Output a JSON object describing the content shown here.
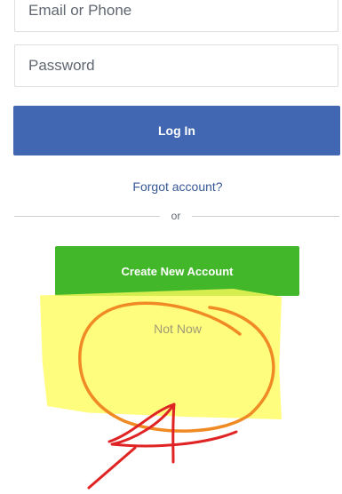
{
  "form": {
    "email_placeholder": "Email or Phone",
    "password_placeholder": "Password",
    "login_label": "Log In",
    "forgot_label": "Forgot account?",
    "or_label": "or",
    "create_label": "Create New Account",
    "not_now_label": "Not Now"
  },
  "colors": {
    "login_blue": "#4267b2",
    "create_green": "#42b72a",
    "link_blue": "#385898",
    "highlight_yellow": "#fffc5a",
    "annotation_orange": "#f08a24",
    "annotation_red": "#e02323"
  }
}
